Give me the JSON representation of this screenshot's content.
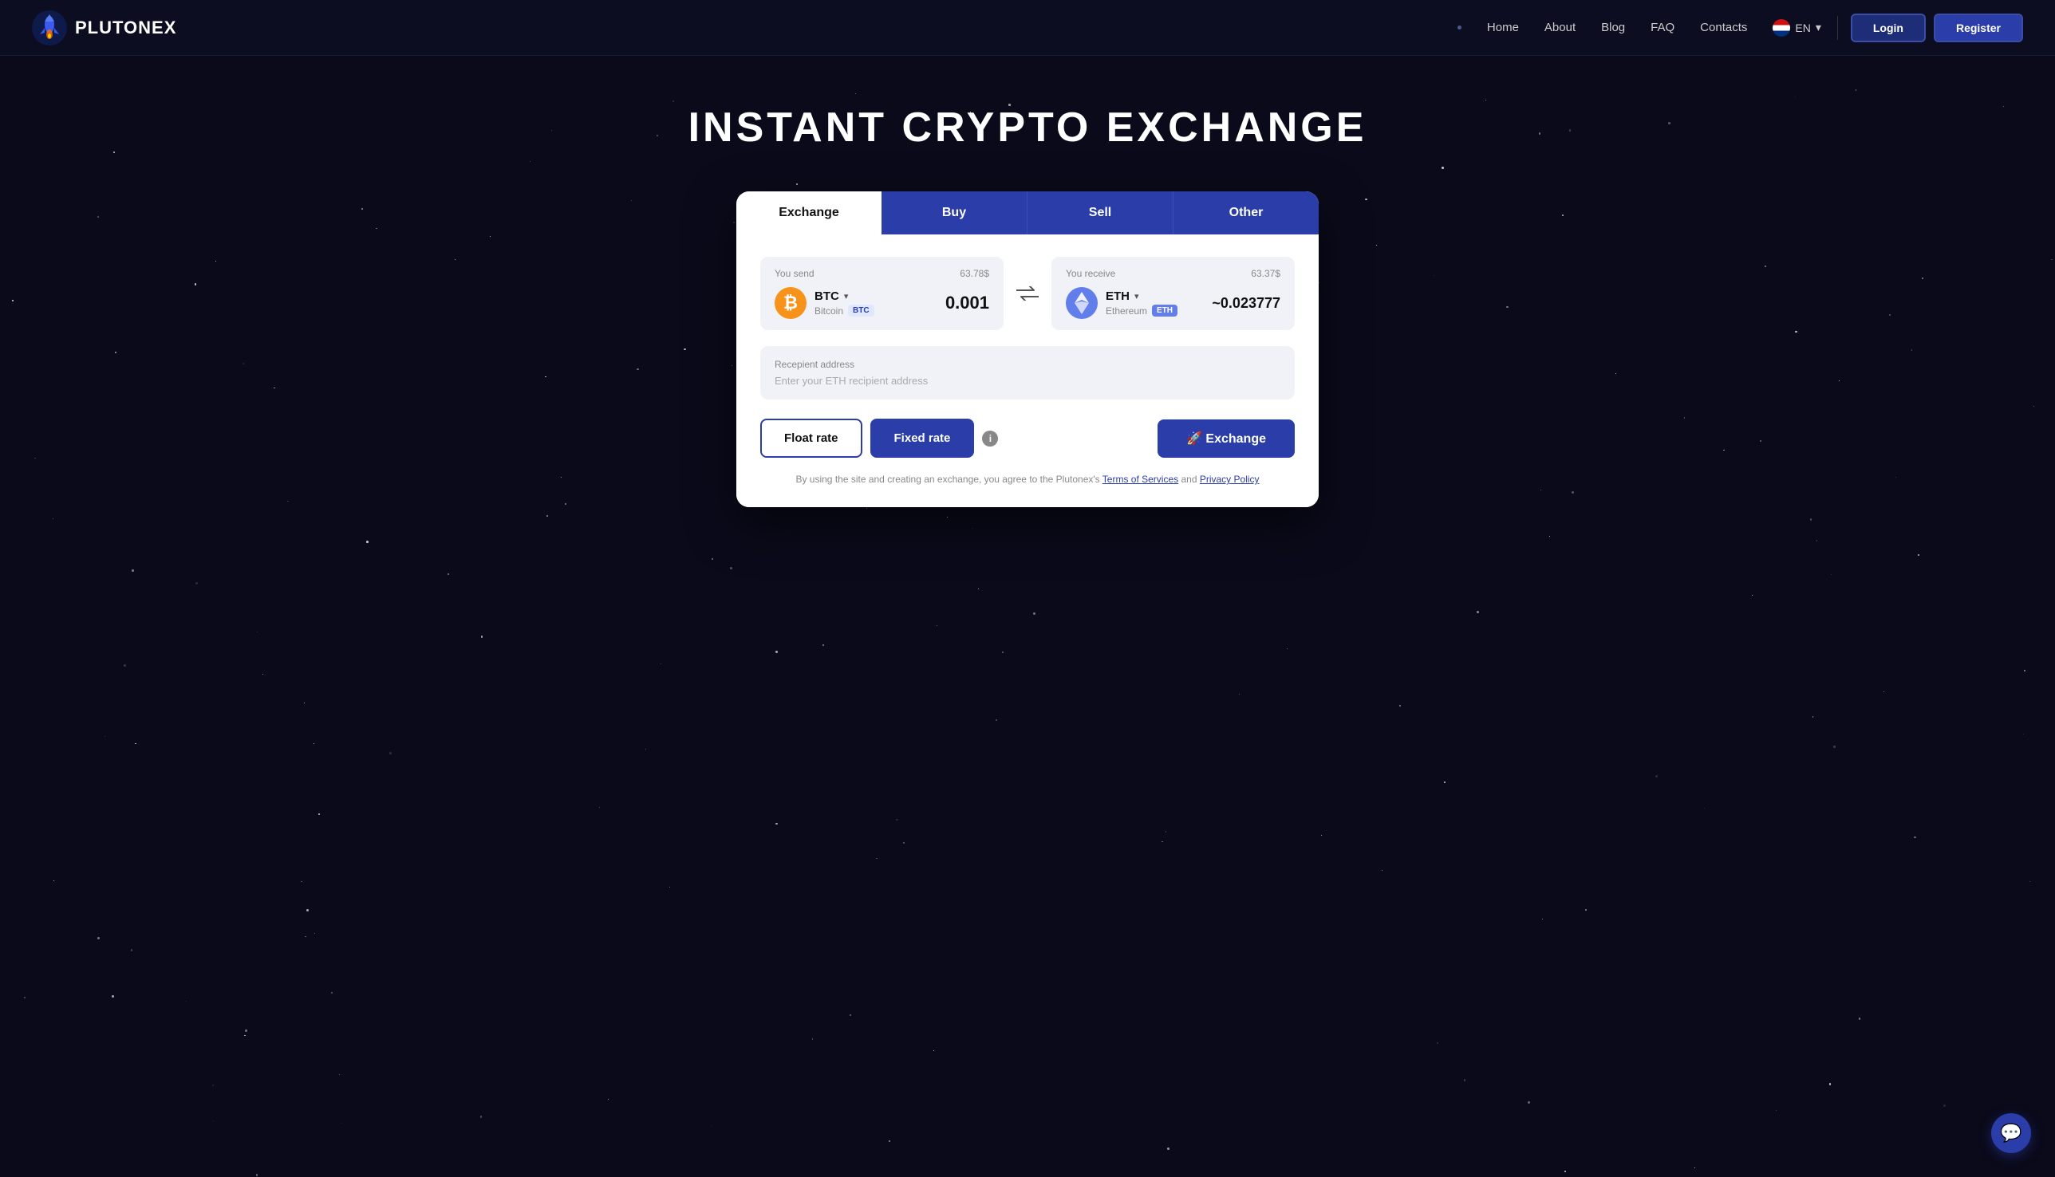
{
  "navbar": {
    "logo_text": "PLUTONEX",
    "nav_dot": "·",
    "links": [
      {
        "label": "Home",
        "id": "home"
      },
      {
        "label": "About",
        "id": "about"
      },
      {
        "label": "Blog",
        "id": "blog"
      },
      {
        "label": "FAQ",
        "id": "faq"
      },
      {
        "label": "Contacts",
        "id": "contacts"
      }
    ],
    "lang": "EN",
    "login_label": "Login",
    "register_label": "Register"
  },
  "hero": {
    "title": "INSTANT CRYPTO EXCHANGE"
  },
  "exchange_card": {
    "tabs": [
      {
        "label": "Exchange",
        "id": "exchange",
        "active": true
      },
      {
        "label": "Buy",
        "id": "buy"
      },
      {
        "label": "Sell",
        "id": "sell"
      },
      {
        "label": "Other",
        "id": "other"
      }
    ],
    "you_send": {
      "label": "You send",
      "usd": "63.78$",
      "coin_ticker": "BTC",
      "coin_fullname": "Bitcoin",
      "coin_badge": "BTC",
      "amount": "0.001"
    },
    "you_receive": {
      "label": "You receive",
      "usd": "63.37$",
      "coin_ticker": "ETH",
      "coin_fullname": "Ethereum",
      "coin_badge": "ETH",
      "amount": "~0.023777"
    },
    "swap_symbol": "⇄",
    "recipient": {
      "label": "Recepient address",
      "placeholder": "Enter your ETH recipient address"
    },
    "float_rate_label": "Float rate",
    "fixed_rate_label": "Fixed rate",
    "info_label": "i",
    "exchange_btn_label": "🚀 Exchange",
    "terms_text": "By using the site and creating an exchange, you agree to the Plutonex's ",
    "terms_link1": "Terms of Services",
    "terms_and": " and ",
    "terms_link2": "Privacy Policy"
  },
  "chat": {
    "icon": "💬"
  }
}
